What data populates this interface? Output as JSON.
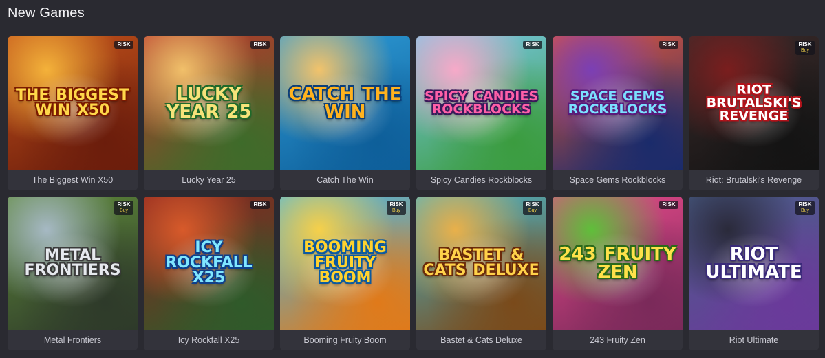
{
  "section": {
    "title": "New Games"
  },
  "games": [
    {
      "title": "The Biggest Win X50",
      "logo": "The Biggest Win X50",
      "badge": "RISK",
      "badge_buy": "",
      "bg": [
        "#c2511a",
        "#f4b23a",
        "#6b1d0c"
      ],
      "logo_color": "#ffd84a",
      "logo_stroke": "#7a1a00"
    },
    {
      "title": "Lucky Year 25",
      "logo": "Lucky Year 25",
      "badge": "RISK",
      "badge_buy": "",
      "bg": [
        "#b8372b",
        "#f1c06a",
        "#3e6b2a"
      ],
      "logo_color": "#f6e27a",
      "logo_stroke": "#1f6a2a"
    },
    {
      "title": "Catch The Win",
      "logo": "Catch The Win",
      "badge": "",
      "badge_buy": "",
      "bg": [
        "#2e9bd6",
        "#f2c36b",
        "#0e5f9a"
      ],
      "logo_color": "#ffb21e",
      "logo_stroke": "#0b3f7a"
    },
    {
      "title": "Spicy Candies Rockblocks",
      "logo": "Spicy Candies Rockblocks",
      "badge": "RISK",
      "badge_buy": "",
      "bg": [
        "#79c7e8",
        "#f7a9c8",
        "#3b9c3f"
      ],
      "logo_color": "#ff5fa8",
      "logo_stroke": "#3a1a5a"
    },
    {
      "title": "Space Gems Rockblocks",
      "logo": "Space Gems Rockblocks",
      "badge": "RISK",
      "badge_buy": "",
      "bg": [
        "#e0573a",
        "#7b3fb5",
        "#1a2b6b"
      ],
      "logo_color": "#7be0ff",
      "logo_stroke": "#5a1a7a"
    },
    {
      "title": "Riot: Brutalski's Revenge",
      "logo": "Riot Brutalski's Revenge",
      "badge": "RISK",
      "badge_buy": "Buy",
      "bg": [
        "#3a2a2a",
        "#7a1e1e",
        "#141414"
      ],
      "logo_color": "#ffffff",
      "logo_stroke": "#b3121a"
    },
    {
      "title": "Metal Frontiers",
      "logo": "Metal Frontiers",
      "badge": "RISK",
      "badge_buy": "Buy",
      "bg": [
        "#5f8a3a",
        "#a6b9c4",
        "#2e3a2a"
      ],
      "logo_color": "#e6e9ee",
      "logo_stroke": "#3a3a3a"
    },
    {
      "title": "Icy Rockfall X25",
      "logo": "Icy Rockfall X25",
      "badge": "RISK",
      "badge_buy": "",
      "bg": [
        "#8a2420",
        "#d85a2a",
        "#2f5a2a"
      ],
      "logo_color": "#7fe6ff",
      "logo_stroke": "#0f3f8a"
    },
    {
      "title": "Booming Fruity Boom",
      "logo": "Booming Fruity Boom",
      "badge": "RISK",
      "badge_buy": "Buy",
      "bg": [
        "#46b8e6",
        "#f6d04a",
        "#e07a1a"
      ],
      "logo_color": "#ffd22e",
      "logo_stroke": "#0c5aa0"
    },
    {
      "title": "Bastet & Cats Deluxe",
      "logo": "Bastet & Cats Deluxe",
      "badge": "RISK",
      "badge_buy": "Buy",
      "bg": [
        "#49b6c9",
        "#e9b04a",
        "#7a4a1a"
      ],
      "logo_color": "#ffd24a",
      "logo_stroke": "#6a2a0a"
    },
    {
      "title": "243 Fruity Zen",
      "logo": "243 Fruity Zen",
      "badge": "RISK",
      "badge_buy": "",
      "bg": [
        "#e64a8a",
        "#5fbf3a",
        "#7a2a5a"
      ],
      "logo_color": "#ffe14a",
      "logo_stroke": "#2a6a1a"
    },
    {
      "title": "Riot Ultimate",
      "logo": "Riot Ultimate",
      "badge": "RISK",
      "badge_buy": "Buy",
      "bg": [
        "#4a5f8a",
        "#2a2a3a",
        "#6a3a9a"
      ],
      "logo_color": "#ffffff",
      "logo_stroke": "#3a2a7a"
    }
  ]
}
